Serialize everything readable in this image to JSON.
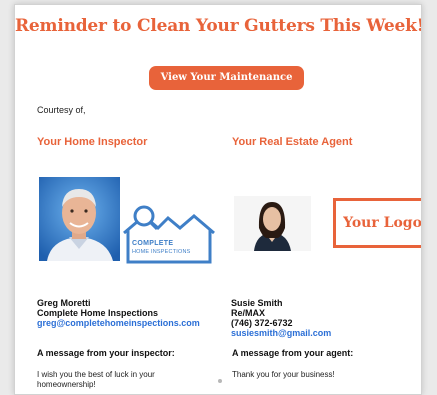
{
  "email": {
    "title": "Reminder to Clean Your Gutters This Week!",
    "cta_label": "View Your Maintenance Task",
    "courtesy": "Courtesy of,"
  },
  "inspector": {
    "role": "Your Home Inspector",
    "name": "Greg Moretti",
    "company": "Complete Home Inspections",
    "email": "greg@completehomeinspections.com",
    "logo_line1": "COMPLETE",
    "logo_line2": "HOME INSPECTIONS",
    "message_heading": "A message from your inspector:",
    "message_line1": "I wish you the best of luck in your",
    "message_line2": "homeownership!"
  },
  "agent": {
    "role": "Your Real Estate Agent",
    "name": "Susie Smith",
    "company": "Re/MAX",
    "phone": "(746) 372-6732",
    "email": "susiesmith@gmail.com",
    "logo_text": "Your Logo",
    "message_heading": "A message from your agent:",
    "message": "Thank you for your business!"
  },
  "colors": {
    "accent": "#e8633a",
    "link": "#2b6fd6",
    "logo_blue": "#3f7fc7"
  }
}
